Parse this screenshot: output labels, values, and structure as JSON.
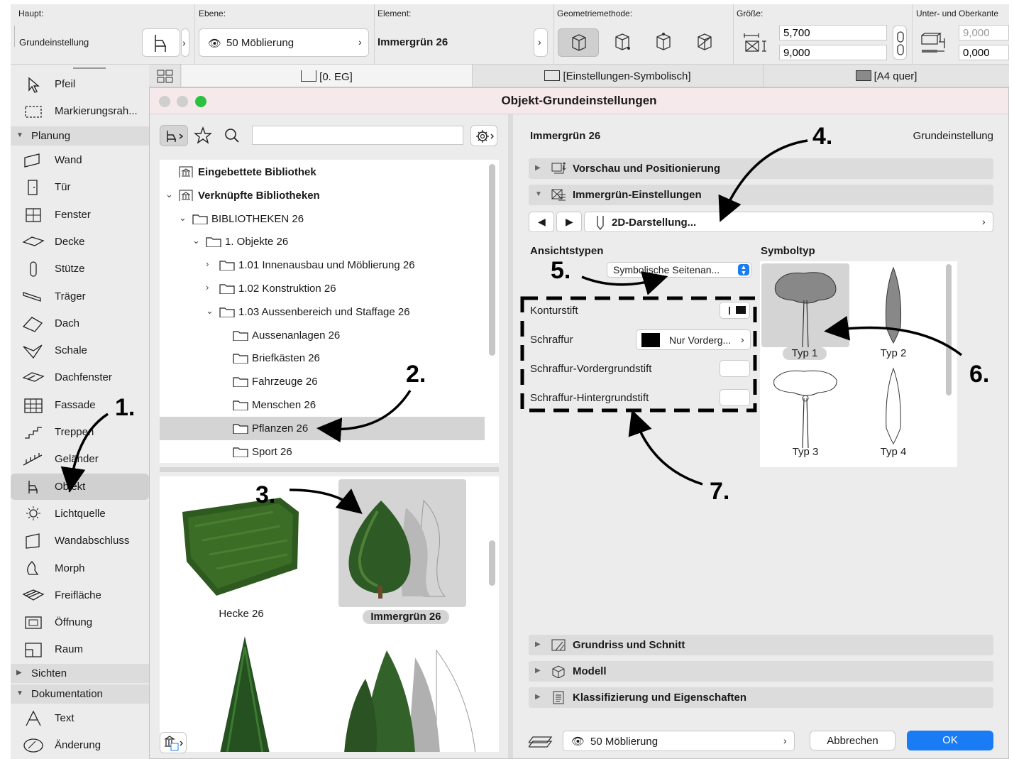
{
  "topbar": {
    "haupt_label": "Haupt:",
    "haupt_value": "Grundeinstellung",
    "ebene_label": "Ebene:",
    "ebene_value": "50 Möblierung",
    "element_label": "Element:",
    "element_value": "Immergrün 26",
    "geometrie_label": "Geometriemethode:",
    "groesse_label": "Größe:",
    "size_a": "5,700",
    "size_b": "9,000",
    "unter_label": "Unter- und Oberkante",
    "ober_value": "9,000",
    "unter_value": "0,000"
  },
  "toolbox": {
    "tools_top": [
      "Pfeil",
      "Markierungsrah..."
    ],
    "group_planung": "Planung",
    "tools_planung": [
      "Wand",
      "Tür",
      "Fenster",
      "Decke",
      "Stütze",
      "Träger",
      "Dach",
      "Schale",
      "Dachfenster",
      "Fassade",
      "Treppen",
      "Geländer",
      "Objekt",
      "Lichtquelle",
      "Wandabschluss",
      "Morph",
      "Freifläche",
      "Öffnung",
      "Raum"
    ],
    "group_sichten": "Sichten",
    "group_dokumentation": "Dokumentation",
    "tools_doku": [
      "Text",
      "Änderung"
    ]
  },
  "tabs": [
    "[0. EG]",
    "[Einstellungen-Symbolisch]",
    "[A4 quer]"
  ],
  "dialog": {
    "title": "Objekt-Grundeinstellungen",
    "search_placeholder": "",
    "tree": [
      "Eingebettete Bibliothek",
      "Verknüpfte Bibliotheken",
      "BIBLIOTHEKEN 26",
      "1. Objekte 26",
      "1.01 Innenausbau und Möblierung 26",
      "1.02 Konstruktion 26",
      "1.03 Aussenbereich und Staffage 26",
      "Aussenanlagen 26",
      "Briefkästen 26",
      "Fahrzeuge 26",
      "Menschen 26",
      "Pflanzen 26",
      "Sport 26"
    ],
    "previews": [
      "Hecke 26",
      "Immergrün 26"
    ],
    "object_name": "Immergrün 26",
    "object_mode": "Grundeinstellung",
    "sections_top": [
      "Vorschau und Positionierung",
      "Immergrün-Einstellungen"
    ],
    "page_selector": "2D-Darstellung...",
    "ansichtstypen_label": "Ansichtstypen",
    "ansichtstypen_value": "Symbolische Seitenan...",
    "symboltyp_label": "Symboltyp",
    "props": [
      "Konturstift",
      "Schraffur",
      "Schraffur-Vordergrundstift",
      "Schraffur-Hintergrundstift"
    ],
    "schraffur_value": "Nur Vorderg...",
    "symbols": [
      "Typ 1",
      "Typ 2",
      "Typ 3",
      "Typ 4"
    ],
    "sections_bottom": [
      "Grundriss und Schnitt",
      "Modell",
      "Klassifizierung und Eigenschaften"
    ],
    "layer_value": "50 Möblierung",
    "cancel_label": "Abbrechen",
    "ok_label": "OK"
  },
  "annotations": [
    "1.",
    "2.",
    "3.",
    "4.",
    "5.",
    "6.",
    "7."
  ],
  "colors": {
    "accent": "#1a7cf5",
    "selection": "#d4d4d4",
    "panel": "#ececec",
    "title": "#f6e9ec"
  }
}
